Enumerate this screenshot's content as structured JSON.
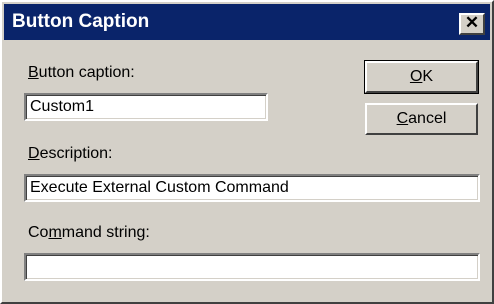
{
  "window": {
    "title": "Button Caption",
    "close_glyph": "✕"
  },
  "fields": {
    "caption": {
      "label_accel": "B",
      "label_rest": "utton caption:",
      "value": "Custom1"
    },
    "description": {
      "label_accel": "D",
      "label_rest": "escription:",
      "value": "Execute External Custom Command"
    },
    "command": {
      "label_pre": "Co",
      "label_accel": "m",
      "label_rest": "mand string:",
      "value": ""
    }
  },
  "buttons": {
    "ok": {
      "accel": "O",
      "rest": "K"
    },
    "cancel": {
      "accel": "C",
      "rest": "ancel"
    }
  },
  "colors": {
    "titlebar": "#0a246a",
    "face": "#d4d0c8"
  },
  "icons": {
    "close": "close-icon"
  }
}
